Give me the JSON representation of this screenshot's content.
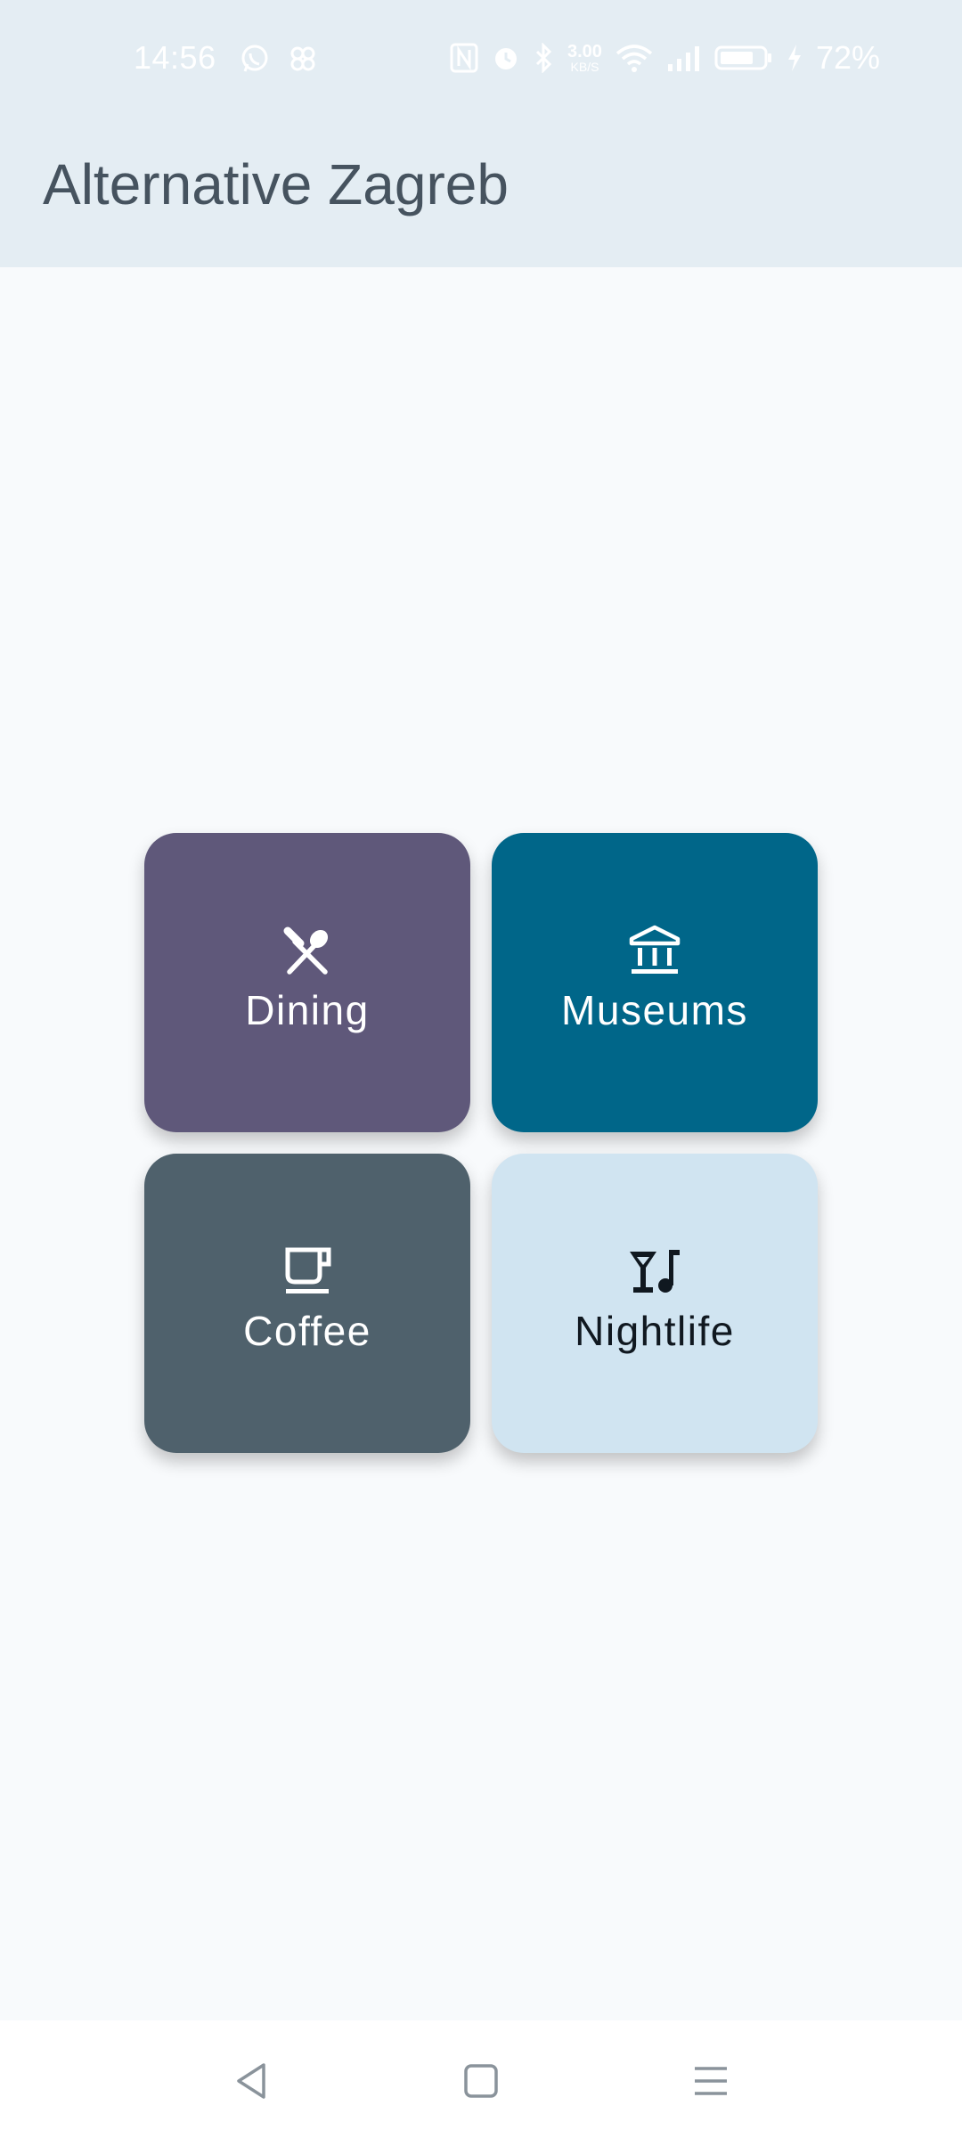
{
  "status_bar": {
    "time": "14:56",
    "network_speed_value": "3.00",
    "network_speed_unit": "KB/S",
    "battery_percent": "72%",
    "icons": [
      "whatsapp-icon",
      "pinwheel-icon",
      "nfc-icon",
      "alarm-icon",
      "bluetooth-icon",
      "wifi-icon",
      "signal-icon",
      "battery-icon",
      "charging-icon"
    ]
  },
  "app_bar": {
    "title": "Alternative Zagreb"
  },
  "categories": [
    {
      "label": "Dining",
      "icon": "dining-icon",
      "bg": "#5f587a",
      "fg": "#ffffff"
    },
    {
      "label": "Museums",
      "icon": "museum-icon",
      "bg": "#006689",
      "fg": "#ffffff"
    },
    {
      "label": "Coffee",
      "icon": "coffee-icon",
      "bg": "#4f616c",
      "fg": "#ffffff"
    },
    {
      "label": "Nightlife",
      "icon": "nightlife-icon",
      "bg": "#d0e4f1",
      "fg": "#101820"
    }
  ],
  "nav_bar": {
    "buttons": [
      "back-icon",
      "home-icon",
      "recents-icon"
    ]
  }
}
